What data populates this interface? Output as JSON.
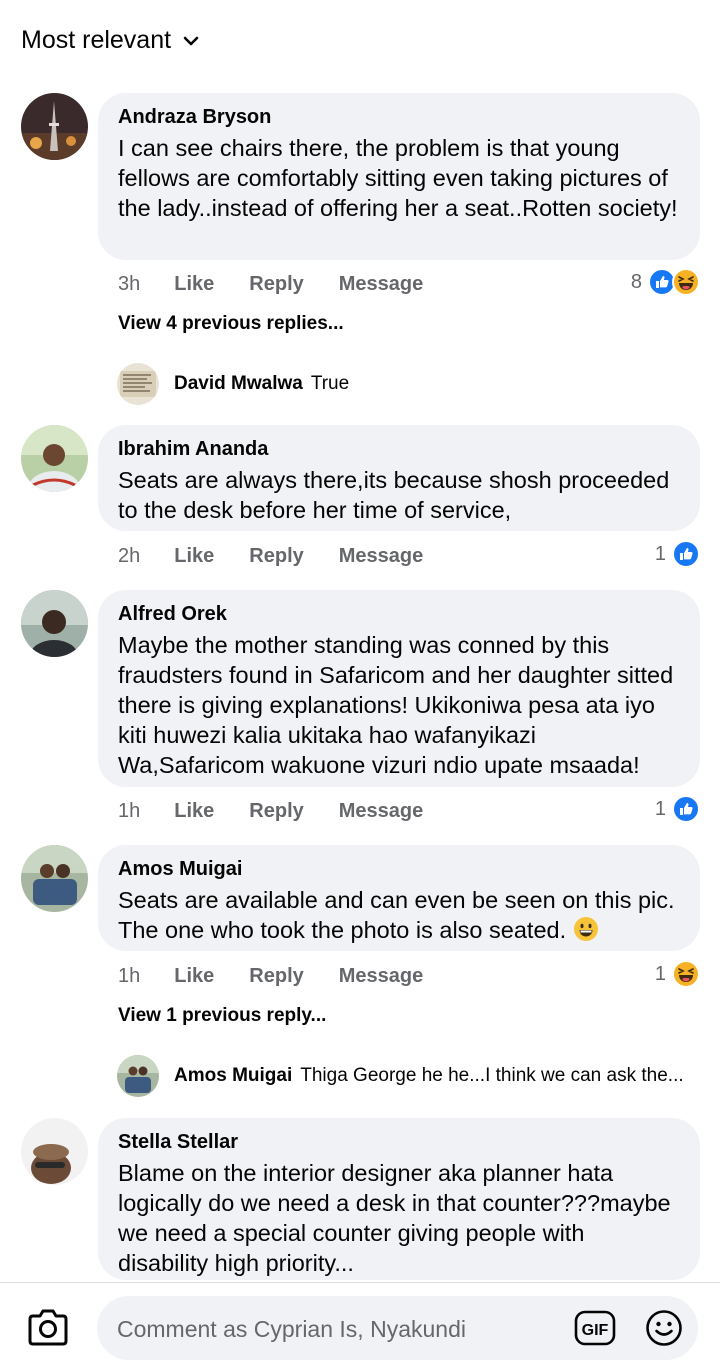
{
  "sort": {
    "label": "Most relevant"
  },
  "comments": [
    {
      "author": "Andraza Bryson",
      "text": "I can see chairs there, the problem is that young fellows are comfortably sitting even taking pictures of the lady..instead of offering her a seat..Rotten society!",
      "time": "3h",
      "like": "Like",
      "reply": "Reply",
      "message": "Message",
      "reaction_count": "8",
      "reactions": [
        "like-reaction-icon",
        "haha-reaction-icon"
      ]
    },
    {
      "author": "Ibrahim Ananda",
      "text": "Seats are always there,its because shosh proceeded to the desk before her time of service,",
      "time": "2h",
      "like": "Like",
      "reply": "Reply",
      "message": "Message",
      "reaction_count": "1",
      "reactions": [
        "like-reaction-icon"
      ]
    },
    {
      "author": "Alfred Orek",
      "text": "Maybe the mother standing was conned by this fraudsters found in Safaricom and her daughter sitted there is giving explanations! Ukikoniwa pesa ata iyo kiti huwezi kalia ukitaka hao wafanyikazi Wa,Safaricom wakuone vizuri ndio upate msaada!",
      "time": "1h",
      "like": "Like",
      "reply": "Reply",
      "message": "Message",
      "reaction_count": "1",
      "reactions": [
        "like-reaction-icon"
      ]
    },
    {
      "author": "Amos Muigai",
      "text": "Seats are available and can even be seen on this pic. The one who took the photo is also seated.",
      "time": "1h",
      "like": "Like",
      "reply": "Reply",
      "message": "Message",
      "reaction_count": "1",
      "reactions": [
        "haha-reaction-icon"
      ]
    },
    {
      "author": "Stella Stellar",
      "text": "Blame on the interior designer aka planner hata logically do we need a desk in that counter???maybe we need a special counter giving people with disability high priority..."
    }
  ],
  "view_previous": [
    {
      "label": "View 4 previous replies..."
    },
    {
      "label": "View 1 previous reply..."
    }
  ],
  "replies": [
    {
      "author": "David Mwalwa",
      "text": "True"
    },
    {
      "author": "Amos Muigai",
      "text": "Thiga George he he...I think we can ask the..."
    }
  ],
  "composer": {
    "placeholder": "Comment as Cyprian Is, Nyakundi",
    "gif_label": "GIF"
  },
  "colors": {
    "like_blue": "#1877f2",
    "secondary_text": "#65676b",
    "bubble_bg": "#f0f2f5",
    "haha_yellow": "#f7b125"
  }
}
